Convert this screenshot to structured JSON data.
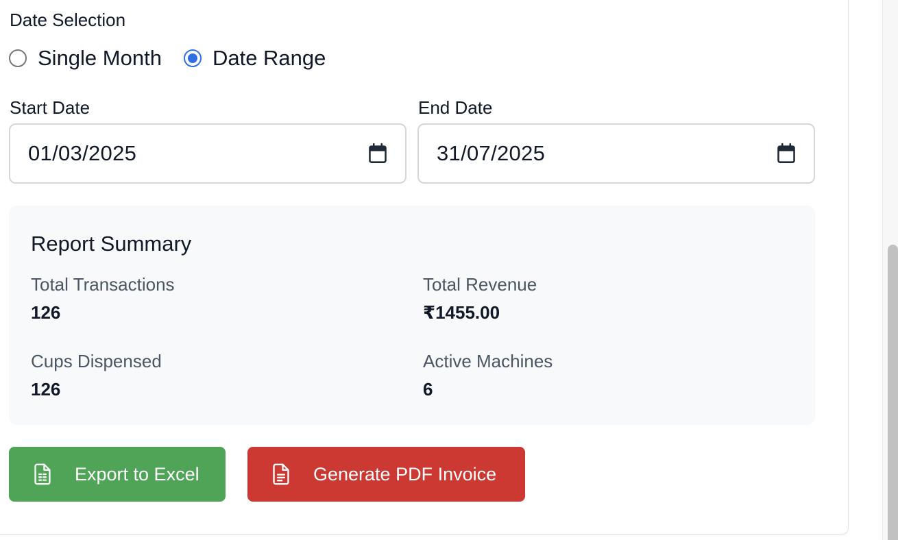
{
  "date_selection": {
    "label": "Date Selection",
    "options": [
      {
        "label": "Single Month",
        "checked": false
      },
      {
        "label": "Date Range",
        "checked": true
      }
    ]
  },
  "start_date": {
    "label": "Start Date",
    "value": "01/03/2025"
  },
  "end_date": {
    "label": "End Date",
    "value": "31/07/2025"
  },
  "summary": {
    "title": "Report Summary",
    "stats": [
      {
        "label": "Total Transactions",
        "value": "126"
      },
      {
        "label": "Total Revenue",
        "value": "₹1455.00"
      },
      {
        "label": "Cups Dispensed",
        "value": "126"
      },
      {
        "label": "Active Machines",
        "value": "6"
      }
    ]
  },
  "actions": {
    "excel_label": "Export to Excel",
    "pdf_label": "Generate PDF Invoice"
  },
  "colors": {
    "accent": "#2f6fe4",
    "excel_button": "#4fa457",
    "pdf_button": "#cc3832",
    "summary_bg": "#f8f9fb"
  },
  "icons": {
    "date_picker": "calendar-icon",
    "excel": "spreadsheet-file-icon",
    "pdf": "document-file-icon"
  }
}
